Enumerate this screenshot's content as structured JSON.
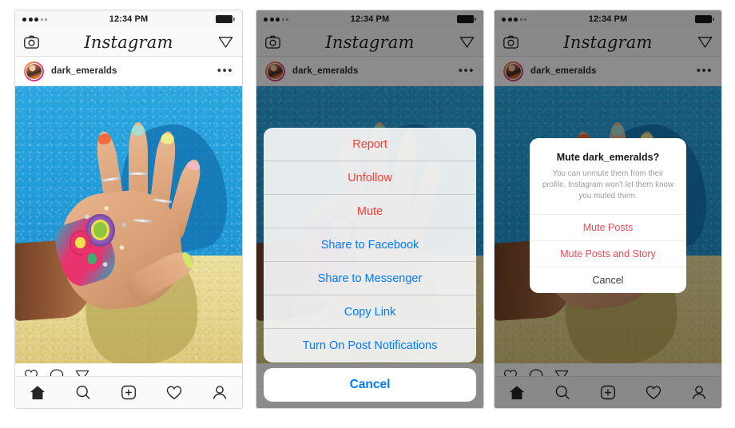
{
  "screens": [
    {
      "id": "feed",
      "status_bar": {
        "signal_filled": 3,
        "signal_empty": 2,
        "time": "12:34 PM",
        "battery": "battery-full"
      },
      "navbar": {
        "left_icon": "camera-icon",
        "title": "Instagram",
        "right_icon": "direct-share-icon"
      },
      "post": {
        "username": "dark_emeralds",
        "more_icon": "more-options-icon",
        "avatar": "user-avatar"
      },
      "photo_alt": "hand with colorful beaded bracelets against blue and yellow wall",
      "actions": [
        "like-heart-icon",
        "comment-bubble-icon",
        "share-paper-plane-icon"
      ],
      "tabbar": [
        "home-icon",
        "search-icon",
        "add-post-icon",
        "activity-heart-icon",
        "profile-icon"
      ]
    },
    {
      "id": "action-sheet",
      "status_bar": {
        "signal_filled": 3,
        "signal_empty": 2,
        "time": "12:34 PM",
        "battery": "battery-full"
      },
      "navbar": {
        "left_icon": "camera-icon",
        "title": "Instagram",
        "right_icon": "direct-share-icon"
      },
      "post": {
        "username": "dark_emeralds",
        "more_icon": "more-options-icon",
        "avatar": "user-avatar"
      },
      "sheet": {
        "items": [
          {
            "label": "Report",
            "style": "destructive"
          },
          {
            "label": "Unfollow",
            "style": "destructive"
          },
          {
            "label": "Mute",
            "style": "destructive"
          },
          {
            "label": "Share to Facebook",
            "style": "default"
          },
          {
            "label": "Share to Messenger",
            "style": "default"
          },
          {
            "label": "Copy Link",
            "style": "default"
          },
          {
            "label": "Turn On Post Notifications",
            "style": "default"
          }
        ],
        "cancel": "Cancel"
      }
    },
    {
      "id": "mute-alert",
      "status_bar": {
        "signal_filled": 3,
        "signal_empty": 2,
        "time": "12:34 PM",
        "battery": "battery-full"
      },
      "navbar": {
        "left_icon": "camera-icon",
        "title": "Instagram",
        "right_icon": "direct-share-icon"
      },
      "post": {
        "username": "dark_emeralds",
        "more_icon": "more-options-icon",
        "avatar": "user-avatar"
      },
      "alert": {
        "title": "Mute dark_emeralds?",
        "message": "You can unmute them from their profile. Instagram won't let them know you muted them.",
        "buttons": [
          {
            "label": "Mute Posts",
            "style": "destructive"
          },
          {
            "label": "Mute Posts and Story",
            "style": "destructive"
          },
          {
            "label": "Cancel",
            "style": "neutral"
          }
        ]
      },
      "actions": [
        "like-heart-icon",
        "comment-bubble-icon",
        "share-paper-plane-icon"
      ],
      "tabbar": [
        "home-icon",
        "search-icon",
        "add-post-icon",
        "activity-heart-icon",
        "profile-icon"
      ]
    }
  ],
  "colors": {
    "ios_blue": "#007aff",
    "ios_red": "#ff3b30",
    "instagram_red": "#ed4956",
    "sheet_bg": "#f3f4f5",
    "chrome_bg": "#fafafa"
  }
}
